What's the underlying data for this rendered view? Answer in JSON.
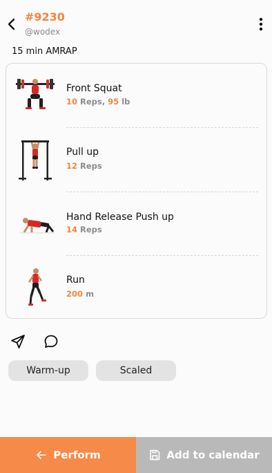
{
  "header": {
    "title": "#9230",
    "author": "@wodex",
    "icons": {
      "back": "chevron-left-icon",
      "more": "more-vertical-icon"
    }
  },
  "workout": {
    "type": "15 min AMRAP",
    "exercises": [
      {
        "name": "Front Squat",
        "reps_value": "10",
        "reps_unit": "Reps,",
        "weight_value": "95",
        "weight_unit": "lb",
        "image": "front-squat-illustration"
      },
      {
        "name": "Pull up",
        "reps_value": "12",
        "reps_unit": "Reps",
        "image": "pull-up-illustration"
      },
      {
        "name": "Hand Release Push up",
        "reps_value": "14",
        "reps_unit": "Reps",
        "image": "push-up-illustration"
      },
      {
        "name": "Run",
        "reps_value": "200",
        "reps_unit": "m",
        "image": "run-illustration"
      }
    ]
  },
  "actions": {
    "share_icon": "send-icon",
    "comment_icon": "comment-icon"
  },
  "tags": [
    "Warm-up",
    "Scaled"
  ],
  "bottom": {
    "perform_label": "Perform",
    "calendar_label": "Add to calendar"
  },
  "colors": {
    "accent": "#f5843f",
    "perform_bg": "#f68a48",
    "calendar_bg": "#b9b9b9"
  }
}
